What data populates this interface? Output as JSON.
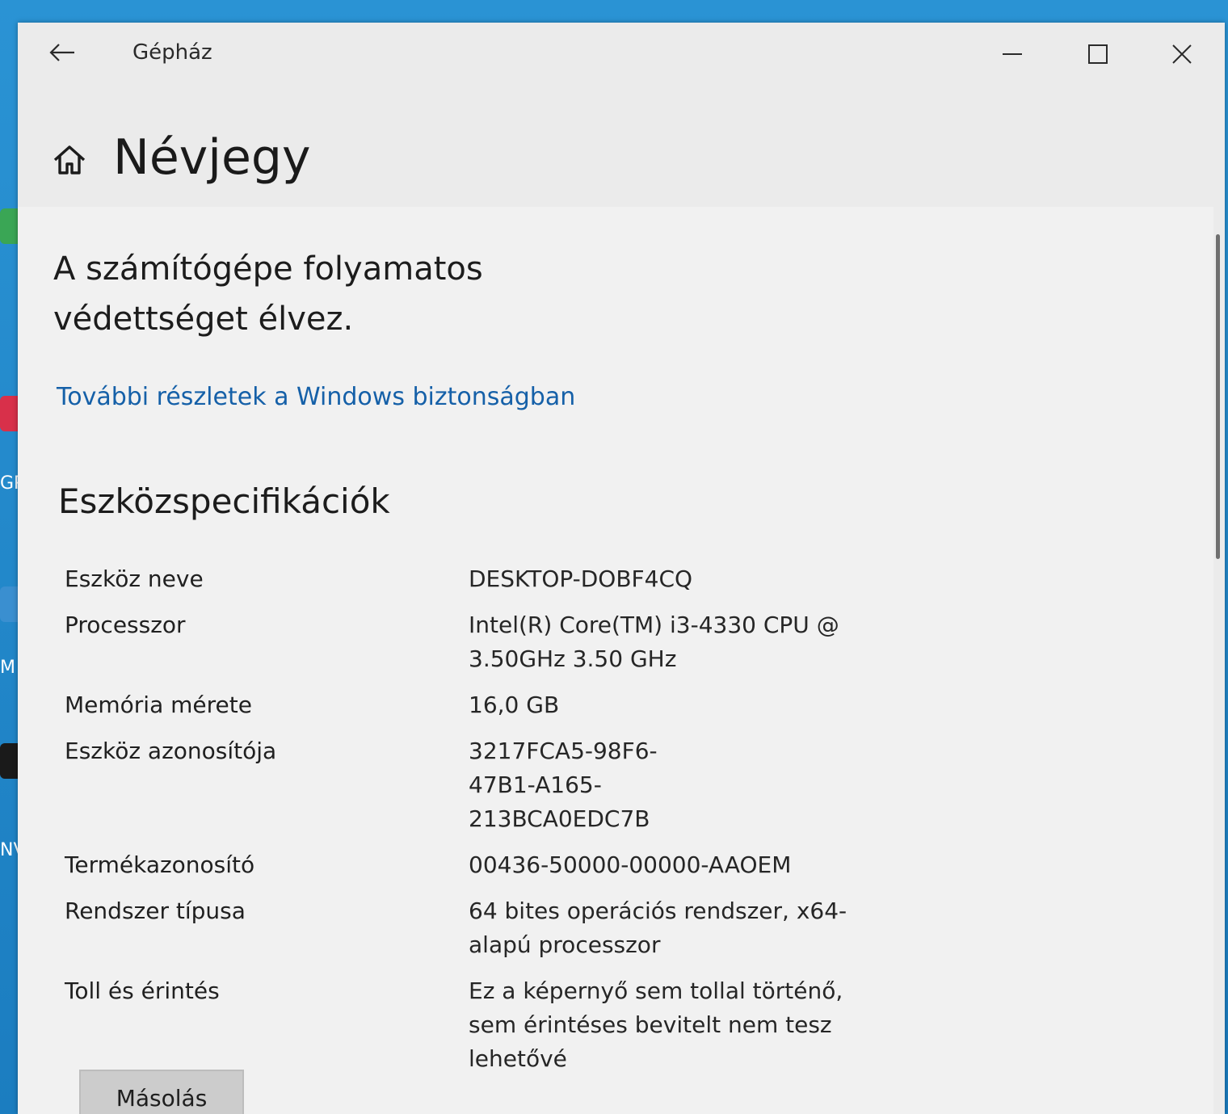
{
  "desktop": {
    "icons": [
      {
        "label": "",
        "color": "#3aa655"
      },
      {
        "label": "GPU",
        "color": "#d8304a"
      },
      {
        "label": "M",
        "color": "#3a8fd0"
      },
      {
        "label": "NV",
        "color": "#1a1a1a"
      }
    ]
  },
  "window": {
    "app_title": "Gépház",
    "back_icon": "back-arrow-icon",
    "minimize_icon": "minimize-icon",
    "maximize_icon": "maximize-icon",
    "close_icon": "close-icon"
  },
  "header": {
    "home_icon": "home-icon",
    "title": "Névjegy"
  },
  "protection": {
    "line1": "A számítógépe folyamatos",
    "line2": "védettséget élvez.",
    "link": "További részletek a Windows biztonságban"
  },
  "specs": {
    "title": "Eszközspecifikációk",
    "rows": [
      {
        "label": "Eszköz neve",
        "value": "DESKTOP-DOBF4CQ"
      },
      {
        "label": "Processzor",
        "value": "Intel(R) Core(TM) i3-4330 CPU @ 3.50GHz   3.50 GHz"
      },
      {
        "label": "Memória mérete",
        "value": "16,0 GB"
      },
      {
        "label": "Eszköz azonosítója",
        "value": "3217FCA5-98F6-47B1-A165-213BCA0EDC7B"
      },
      {
        "label": "Termékazonosító",
        "value": "00436-50000-00000-AAOEM"
      },
      {
        "label": "Rendszer típusa",
        "value": "64 bites operációs rendszer, x64-alapú processzor"
      },
      {
        "label": "Toll és érintés",
        "value": "Ez a képernyő sem tollal történő, sem érintéses bevitelt nem tesz lehetővé"
      }
    ],
    "copy_button": "Másolás"
  },
  "colors": {
    "link": "#1560a8",
    "window_bg": "#ebebeb",
    "desktop_bg": "#1f86c9"
  }
}
